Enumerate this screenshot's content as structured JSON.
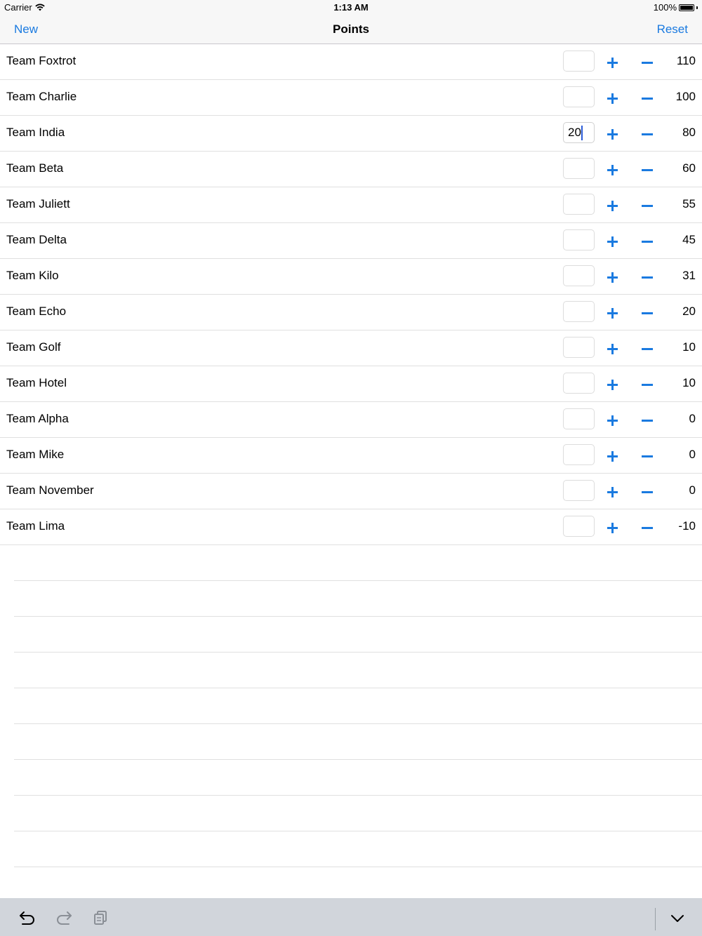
{
  "status_bar": {
    "carrier": "Carrier",
    "time": "1:13 AM",
    "battery": "100%"
  },
  "nav": {
    "left_label": "New",
    "title": "Points",
    "right_label": "Reset"
  },
  "teams": [
    {
      "name": "Team Foxtrot",
      "input": "",
      "score": "110"
    },
    {
      "name": "Team Charlie",
      "input": "",
      "score": "100"
    },
    {
      "name": "Team India",
      "input": "20",
      "score": "80"
    },
    {
      "name": "Team Beta",
      "input": "",
      "score": "60"
    },
    {
      "name": "Team Juliett",
      "input": "",
      "score": "55"
    },
    {
      "name": "Team Delta",
      "input": "",
      "score": "45"
    },
    {
      "name": "Team Kilo",
      "input": "",
      "score": "31"
    },
    {
      "name": "Team Echo",
      "input": "",
      "score": "20"
    },
    {
      "name": "Team Golf",
      "input": "",
      "score": "10"
    },
    {
      "name": "Team Hotel",
      "input": "",
      "score": "10"
    },
    {
      "name": "Team Alpha",
      "input": "",
      "score": "0"
    },
    {
      "name": "Team Mike",
      "input": "",
      "score": "0"
    },
    {
      "name": "Team November",
      "input": "",
      "score": "0"
    },
    {
      "name": "Team Lima",
      "input": "",
      "score": "-10"
    }
  ],
  "colors": {
    "accent": "#1a7ae0",
    "separator": "#e0e0e0",
    "toolbar_bg": "#d1d5db"
  },
  "keyboard_toolbar": {
    "icons": [
      "undo-icon",
      "redo-icon",
      "paste-icon",
      "dismiss-keyboard-icon"
    ]
  }
}
